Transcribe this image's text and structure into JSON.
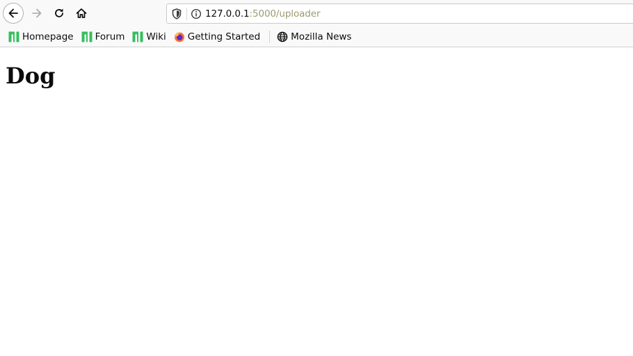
{
  "toolbar": {
    "back_icon": "arrow-left-icon",
    "forward_icon": "arrow-right-icon",
    "reload_icon": "reload-icon",
    "home_icon": "home-icon"
  },
  "urlbar": {
    "host": "127.0.0.1",
    "rest": ":5000/uploader",
    "shield_icon": "shield-icon",
    "info_icon": "info-icon"
  },
  "bookmarks": [
    {
      "label": "Homepage",
      "icon": "manjaro-icon"
    },
    {
      "label": "Forum",
      "icon": "manjaro-icon"
    },
    {
      "label": "Wiki",
      "icon": "manjaro-icon"
    },
    {
      "label": "Getting Started",
      "icon": "firefox-icon"
    },
    {
      "label": "Mozilla News",
      "icon": "globe-icon"
    }
  ],
  "page": {
    "heading": "Dog"
  },
  "colors": {
    "manjaro_green": "#35bf5c",
    "toolbar_bg": "#f9f9fa",
    "url_rest": "#9b9b6f"
  }
}
